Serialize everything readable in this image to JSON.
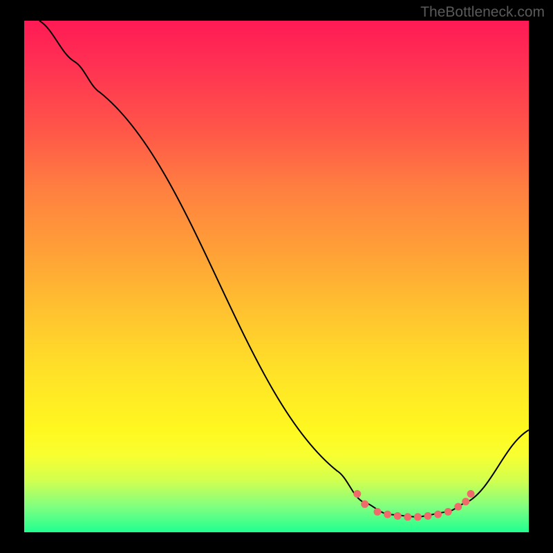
{
  "watermark": "TheBottleneck.com",
  "chart_data": {
    "type": "line",
    "title": "",
    "xlabel": "",
    "ylabel": "",
    "xlim": [
      0,
      100
    ],
    "ylim": [
      0,
      100
    ],
    "series": [
      {
        "name": "curve",
        "points": [
          {
            "x": 3,
            "y": 100
          },
          {
            "x": 10,
            "y": 92
          },
          {
            "x": 15,
            "y": 86
          },
          {
            "x": 62,
            "y": 12
          },
          {
            "x": 67,
            "y": 6
          },
          {
            "x": 72,
            "y": 3.5
          },
          {
            "x": 78,
            "y": 3
          },
          {
            "x": 84,
            "y": 4
          },
          {
            "x": 88,
            "y": 6
          },
          {
            "x": 100,
            "y": 20
          }
        ]
      },
      {
        "name": "highlight-dots",
        "points": [
          {
            "x": 66,
            "y": 7.5
          },
          {
            "x": 67.5,
            "y": 5.5
          },
          {
            "x": 70,
            "y": 4
          },
          {
            "x": 72,
            "y": 3.5
          },
          {
            "x": 74,
            "y": 3.2
          },
          {
            "x": 76,
            "y": 3
          },
          {
            "x": 78,
            "y": 3
          },
          {
            "x": 80,
            "y": 3.2
          },
          {
            "x": 82,
            "y": 3.5
          },
          {
            "x": 84,
            "y": 4
          },
          {
            "x": 86,
            "y": 5
          },
          {
            "x": 87.5,
            "y": 6
          },
          {
            "x": 88.5,
            "y": 7.5
          }
        ]
      }
    ]
  }
}
